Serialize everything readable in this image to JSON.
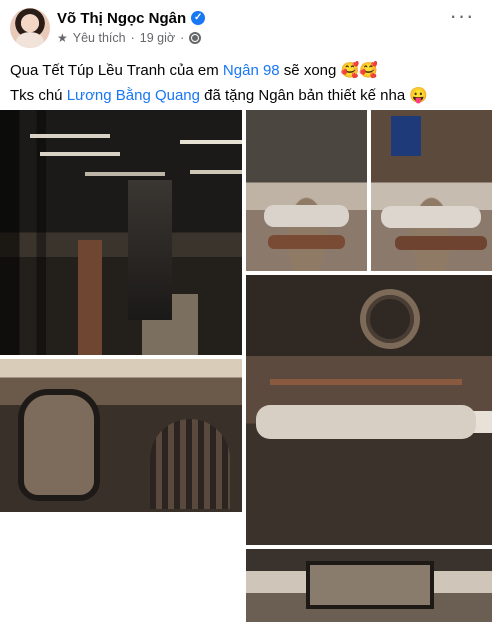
{
  "post": {
    "author": "Võ Thị Ngọc Ngân",
    "verified_icon": "verified-badge-icon",
    "meta": {
      "favorite_label": "Yêu thích",
      "separator": "·",
      "time": "19 giờ",
      "audience_icon": "globe-icon"
    },
    "more_label": "···",
    "text": {
      "line1_prefix": "Qua Tết Túp Lều Tranh của em ",
      "line1_link": "Ngân 98",
      "line1_suffix": " sẽ xong ",
      "line1_emoji": "🥰🥰",
      "line2_prefix": "Tks chú ",
      "line2_link": "Lương Bằng Quang",
      "line2_suffix": " đã tặng Ngân bản thiết kế nha ",
      "line2_emoji": "😛"
    }
  },
  "photos": [
    "dark-entry-hall-photo",
    "living-room-photo-1",
    "living-room-photo-2",
    "living-room-chandelier-photo",
    "mirror-stair-photo",
    "ceiling-detail-photo"
  ],
  "colors": {
    "link": "#1877f2",
    "secondary_text": "#65676b",
    "primary_text": "#050505"
  }
}
